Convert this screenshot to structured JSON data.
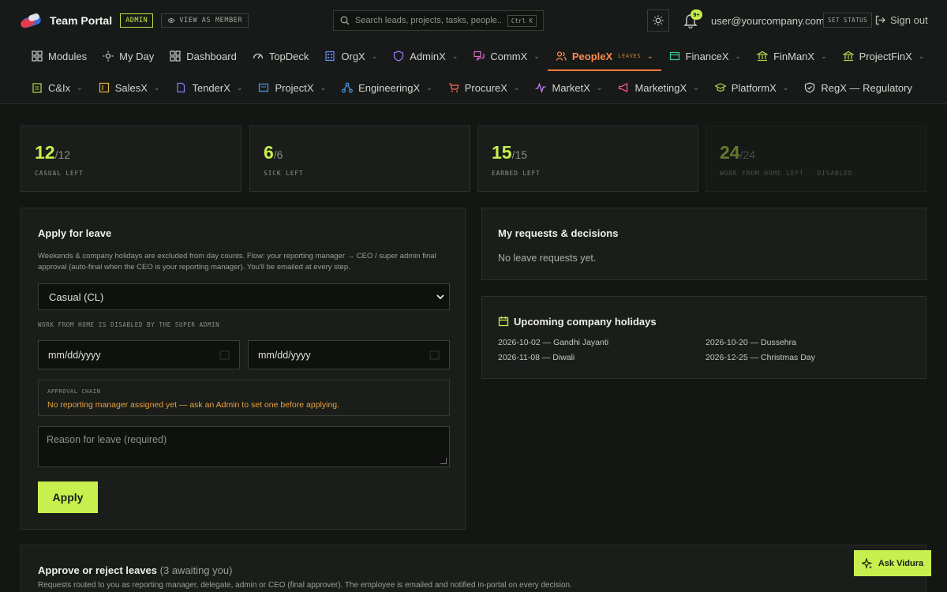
{
  "header": {
    "app_name": "Team Portal",
    "role_badge": "ADMIN",
    "view_as_label": "VIEW AS MEMBER",
    "search_placeholder": "Search leads, projects, tasks, people...",
    "search_shortcut": "Ctrl K",
    "notification_count": "9+",
    "user_email": "user@yourcompany.com",
    "set_status_label": "SET STATUS",
    "signout_label": "Sign out"
  },
  "nav_primary": [
    {
      "label": "Modules",
      "icon": "grid-icon"
    },
    {
      "label": "My Day",
      "icon": "sun-icon"
    },
    {
      "label": "Dashboard",
      "icon": "grid-icon"
    },
    {
      "label": "TopDeck",
      "icon": "gauge-icon"
    },
    {
      "label": "OrgX",
      "icon": "building-icon",
      "dropdown": true
    },
    {
      "label": "AdminX",
      "icon": "shield-icon",
      "dropdown": true
    },
    {
      "label": "CommX",
      "icon": "chat-icon",
      "dropdown": true
    },
    {
      "label": "PeopleX",
      "sublabel": "LEAVES",
      "icon": "people-icon",
      "dropdown": true,
      "active": true
    },
    {
      "label": "FinanceX",
      "icon": "wallet-icon",
      "dropdown": true
    },
    {
      "label": "FinManX",
      "icon": "bank-icon",
      "dropdown": true
    },
    {
      "label": "ProjectFinX",
      "icon": "bank-icon",
      "dropdown": true
    }
  ],
  "nav_secondary": [
    {
      "label": "C&Ix",
      "icon": "clipboard-icon",
      "dropdown": true
    },
    {
      "label": "SalesX",
      "icon": "tag-icon",
      "dropdown": true
    },
    {
      "label": "TenderX",
      "icon": "document-icon",
      "dropdown": true
    },
    {
      "label": "ProjectX",
      "icon": "folder-icon",
      "dropdown": true
    },
    {
      "label": "EngineeringX",
      "icon": "network-icon",
      "dropdown": true
    },
    {
      "label": "ProcureX",
      "icon": "cart-icon",
      "dropdown": true
    },
    {
      "label": "MarketX",
      "icon": "pulse-icon",
      "dropdown": true
    },
    {
      "label": "MarketingX",
      "icon": "megaphone-icon",
      "dropdown": true
    },
    {
      "label": "PlatformX",
      "icon": "graduation-icon",
      "dropdown": true
    },
    {
      "label": "RegX — Regulatory",
      "icon": "shield-check-icon"
    }
  ],
  "balances": [
    {
      "value": "12",
      "total": "/12",
      "label": "CASUAL LEFT"
    },
    {
      "value": "6",
      "total": "/6",
      "label": "SICK LEFT"
    },
    {
      "value": "15",
      "total": "/15",
      "label": "EARNED LEFT"
    },
    {
      "value": "24",
      "total": "/24",
      "label": "WORK FROM HOME LEFT · DISABLED"
    }
  ],
  "apply": {
    "title": "Apply for leave",
    "description": "Weekends & company holidays are excluded from day counts. Flow: your reporting manager → CEO / super admin final approval (auto-final when the CEO is your reporting manager). You'll be emailed at every step.",
    "leave_type": "Casual (CL)",
    "wfh_note": "WORK FROM HOME IS DISABLED BY THE SUPER ADMIN",
    "start_date_placeholder": "mm/dd/yyyy",
    "end_date_placeholder": "mm/dd/yyyy",
    "chain_title": "APPROVAL CHAIN",
    "chain_message": "No reporting manager assigned yet — ask an Admin to set one before applying.",
    "reason_placeholder": "Reason for leave (required)",
    "submit_label": "Apply"
  },
  "requests": {
    "title": "My requests & decisions",
    "empty": "No leave requests yet."
  },
  "holidays": {
    "title": "Upcoming company holidays",
    "items": [
      "2026-10-02 — Gandhi Jayanti",
      "2026-10-20 — Dussehra",
      "2026-11-08 — Diwali",
      "2026-12-25 — Christmas Day"
    ]
  },
  "approvals": {
    "title": "Approve or reject leaves",
    "count": "(3 awaiting you)",
    "description": "Requests routed to you as reporting manager, delegate, admin or CEO (final approver). The employee is emailed and notified in-portal on every decision."
  },
  "assistant": {
    "label": "Ask Vidura"
  },
  "colors": {
    "accent": "#c7ef4e",
    "active_nav": "#ff7a3a",
    "warning": "#e8a23d",
    "background": "#141614"
  }
}
